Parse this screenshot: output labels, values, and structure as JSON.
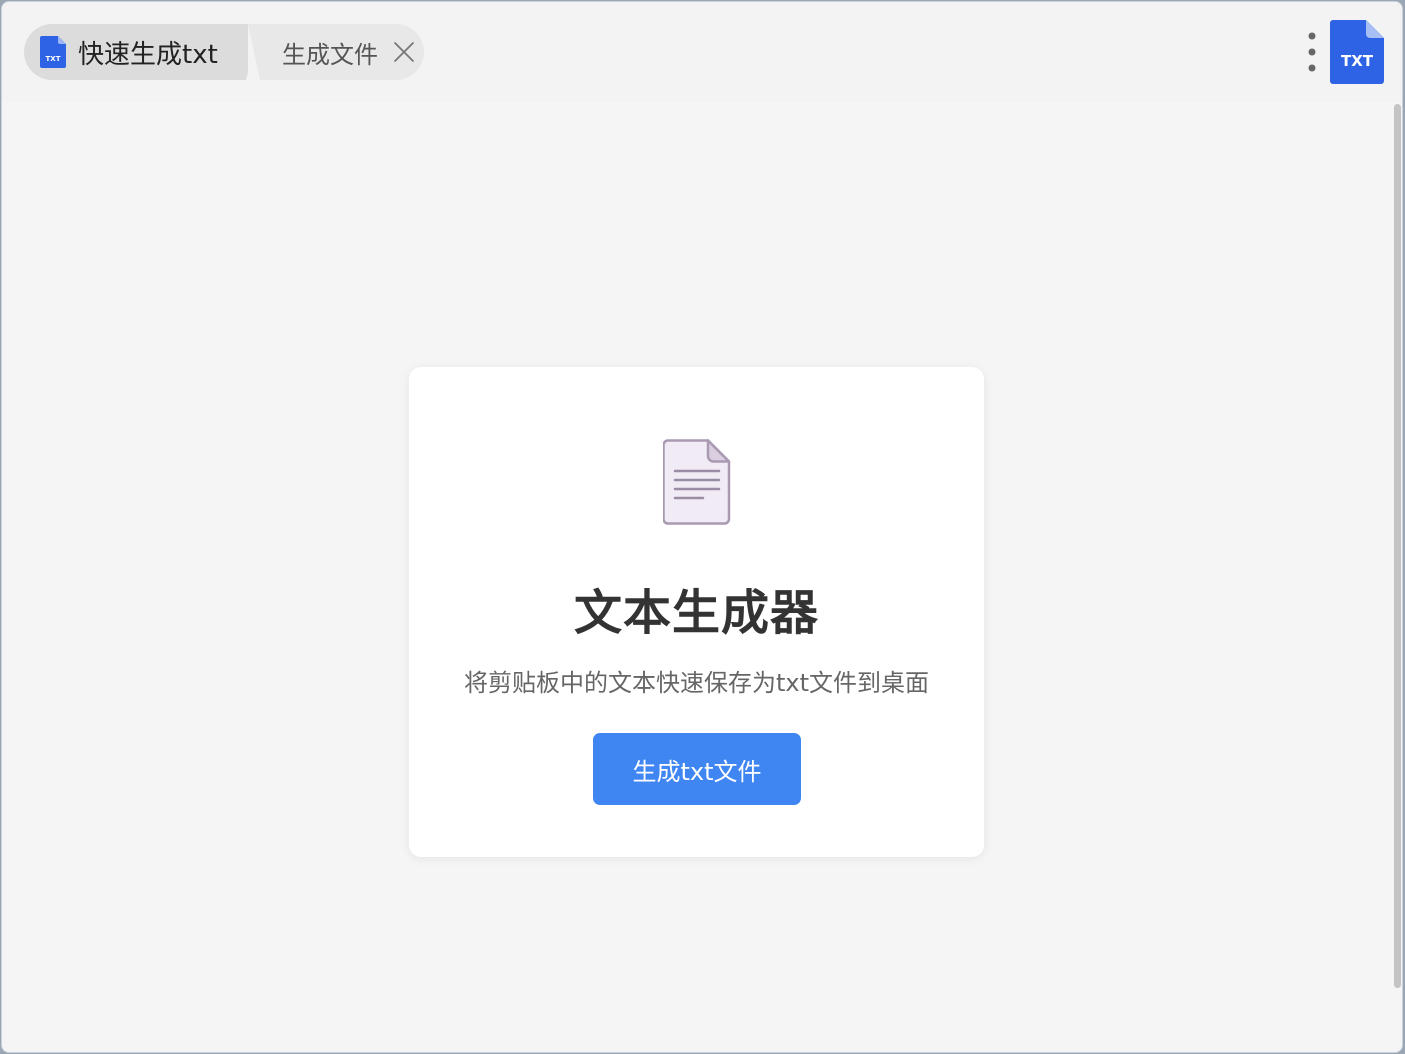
{
  "colors": {
    "accent": "#3f86f2",
    "brand_blue": "#2f63e6",
    "window_bg": "#f5f5f5",
    "card_bg": "#ffffff",
    "doc_icon_fill": "#f1ebf5",
    "doc_icon_stroke": "#a99ab2"
  },
  "tabs": [
    {
      "label": "快速生成txt",
      "icon": "txt-file-icon",
      "active": true
    },
    {
      "label": "生成文件",
      "close_icon": "close-icon",
      "active": false
    }
  ],
  "header": {
    "menu_icon": "more-vertical-icon",
    "brand_icon": "txt-file-icon",
    "brand_icon_text": "TXT",
    "app_icon_text": "TXT"
  },
  "main": {
    "illustration_icon": "document-icon",
    "title": "文本生成器",
    "description": "将剪贴板中的文本快速保存为txt文件到桌面",
    "generate_button_label": "生成txt文件"
  }
}
